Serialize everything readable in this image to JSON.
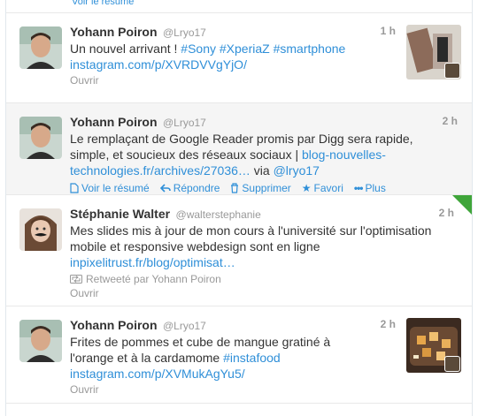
{
  "stub": {
    "label": "Voir le résumé"
  },
  "tweets": [
    {
      "fullname": "Yohann Poiron",
      "username": "@Lryo17",
      "time": "1 h",
      "text_plain": "Un nouvel arrivant ! ",
      "hashtags": [
        "#Sony",
        "#XperiaZ",
        "#smartphone"
      ],
      "link": "instagram.com/p/XVRDVVgYjO/",
      "open": "Ouvrir"
    },
    {
      "fullname": "Yohann Poiron",
      "username": "@Lryo17",
      "time": "2 h",
      "text_line1": "Le remplaçant de Google Reader promis par Digg sera rapide,",
      "text_line2a": "simple, et soucieux des réseaux sociaux | ",
      "link_part1": "blog-nouvelles-",
      "link_part2": "technologies.fr/archives/27036…",
      "via": " via ",
      "mention": "@lryo17",
      "actions": {
        "summary": "Voir le résumé",
        "reply": "Répondre",
        "delete": "Supprimer",
        "favorite": "Favori",
        "more": "Plus"
      }
    },
    {
      "fullname": "Stéphanie Walter",
      "username": "@walterstephanie",
      "time": "2 h",
      "text_line1": "Mes slides mis à jour de mon cours à l'université sur l'optimisation",
      "text_line2": "mobile et responsive webdesign sont en ligne",
      "link": "inpixelitrust.fr/blog/optimisat…",
      "retweeted_by": "Retweeté par Yohann Poiron",
      "open": "Ouvrir"
    },
    {
      "fullname": "Yohann Poiron",
      "username": "@Lryo17",
      "time": "2 h",
      "text_line1": "Frites de pommes et cube de mangue gratiné à",
      "text_line2a": "l'orange et à la cardamome ",
      "hashtag": "#instafood",
      "link": "instagram.com/p/XVMukAgYu5/",
      "open": "Ouvrir"
    }
  ],
  "colors": {
    "link": "#2f8fd8",
    "hover_bg": "#f5f5f5",
    "muted": "#999999",
    "corner": "#3fa53a"
  }
}
